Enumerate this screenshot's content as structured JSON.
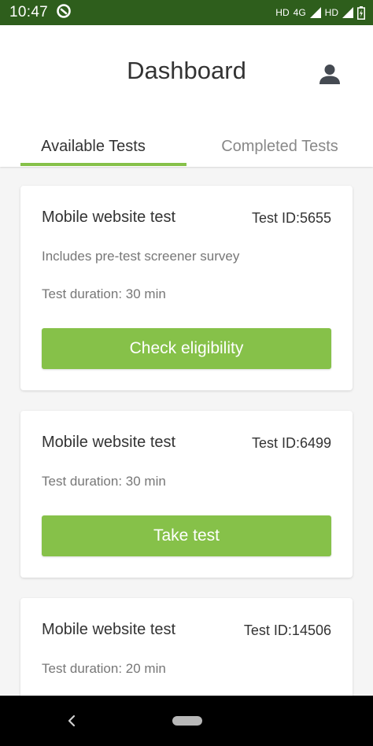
{
  "status_bar": {
    "time": "10:47",
    "network_labels": [
      "HD",
      "4G",
      "HD"
    ]
  },
  "header": {
    "title": "Dashboard"
  },
  "tabs": [
    {
      "label": "Available Tests",
      "active": true
    },
    {
      "label": "Completed Tests",
      "active": false
    }
  ],
  "cards": [
    {
      "title": "Mobile website test",
      "test_id": "Test ID:5655",
      "note": "Includes pre-test screener survey",
      "duration": "Test duration: 30 min",
      "button_label": "Check eligibility"
    },
    {
      "title": "Mobile website test",
      "test_id": "Test ID:6499",
      "duration": "Test duration: 30 min",
      "button_label": "Take test"
    },
    {
      "title": "Mobile website test",
      "test_id": "Test ID:14506",
      "duration": "Test duration: 20 min"
    }
  ],
  "colors": {
    "accent": "#86c149",
    "status_bar": "#2e5e1c",
    "text_primary": "#333333",
    "text_secondary": "#777777"
  },
  "icons": {
    "status_app": "tracking-icon",
    "profile": "user-icon",
    "nav_back": "back-icon",
    "nav_home": "home-pill-icon"
  }
}
